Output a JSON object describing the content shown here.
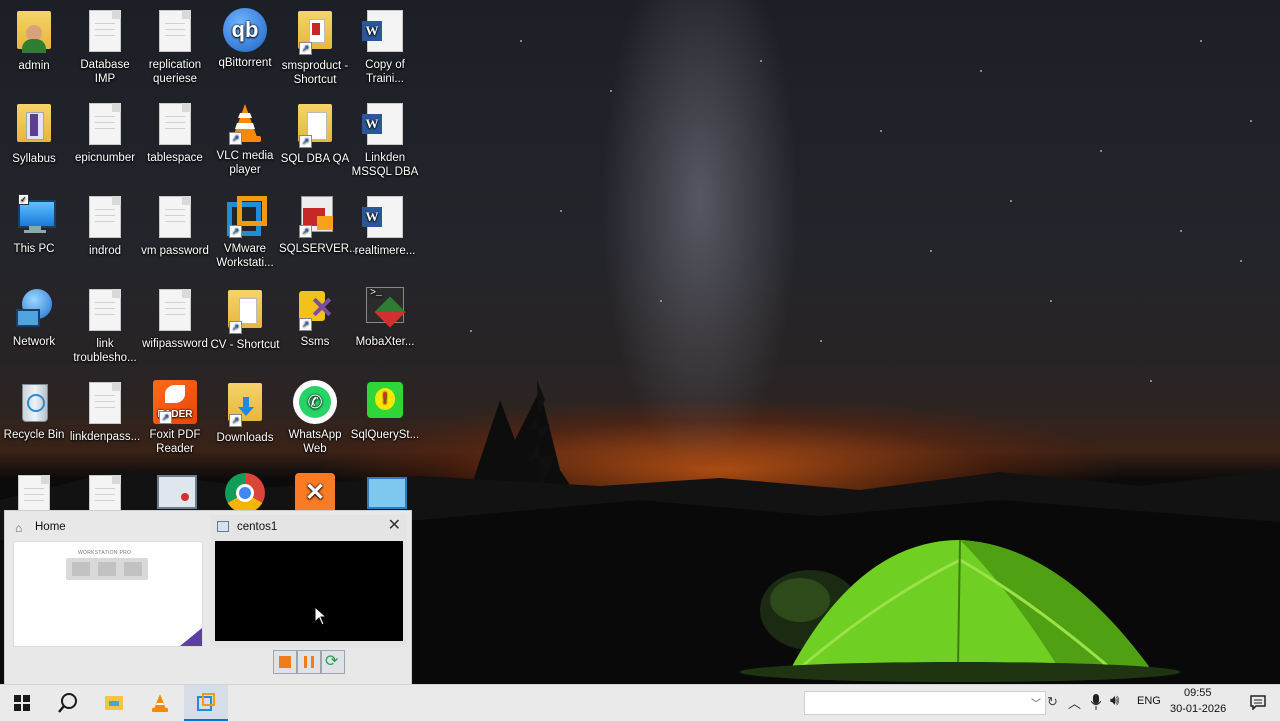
{
  "desktop": {
    "icons": [
      {
        "label": "admin"
      },
      {
        "label": "Database IMP"
      },
      {
        "label": "replication queriese"
      },
      {
        "label": "qBittorrent"
      },
      {
        "label": "smsproduct - Shortcut"
      },
      {
        "label": "Copy of Traini..."
      },
      {
        "label": "Syllabus"
      },
      {
        "label": "epicnumber"
      },
      {
        "label": "tablespace"
      },
      {
        "label": "VLC media player"
      },
      {
        "label": "SQL DBA QA"
      },
      {
        "label": "Linkden MSSQL DBA"
      },
      {
        "label": "This PC"
      },
      {
        "label": "indrod"
      },
      {
        "label": "vm password"
      },
      {
        "label": "VMware Workstati..."
      },
      {
        "label": "SQLSERVER..."
      },
      {
        "label": "realtimere..."
      },
      {
        "label": "Network"
      },
      {
        "label": "link troublesho..."
      },
      {
        "label": "wifipassword"
      },
      {
        "label": "CV - Shortcut"
      },
      {
        "label": "Ssms"
      },
      {
        "label": "MobaXter..."
      },
      {
        "label": "Recycle Bin"
      },
      {
        "label": "linkdenpass..."
      },
      {
        "label": "Foxit PDF Reader"
      },
      {
        "label": "Downloads"
      },
      {
        "label": "WhatsApp Web"
      },
      {
        "label": "SqlQuerySt..."
      }
    ]
  },
  "popup": {
    "home_title": "Home",
    "vm_title": "centos1",
    "home_thumb_caption": "WORKSTATION PRO"
  },
  "taskbar": {
    "language": "ENG",
    "time": "09:55",
    "date": "30-01-2026",
    "search_placeholder": ""
  },
  "colors": {
    "taskbar_bg": "#eaeaea",
    "accent": "#0078d7",
    "tent": "#7dde2a"
  }
}
